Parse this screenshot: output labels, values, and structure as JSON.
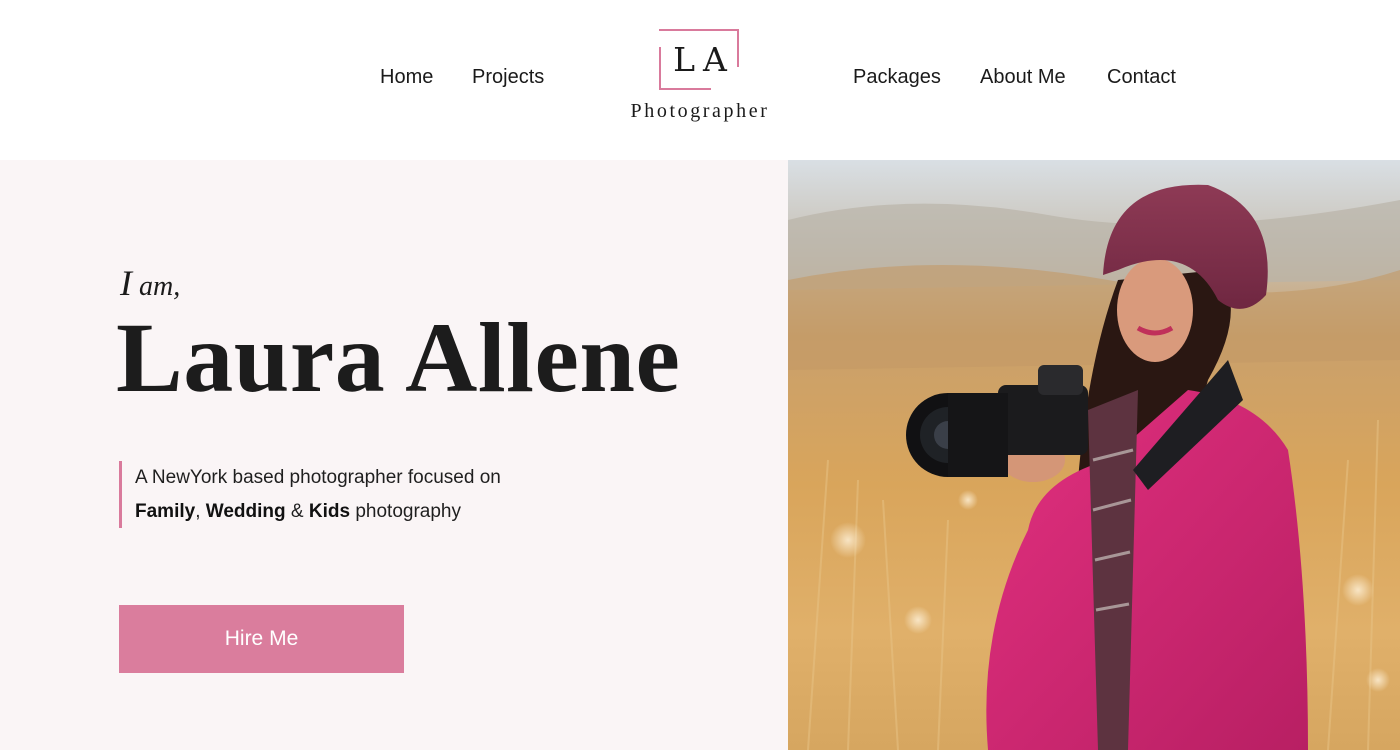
{
  "nav": {
    "left_items": [
      {
        "label": "Home"
      },
      {
        "label": "Projects"
      }
    ],
    "right_items": [
      {
        "label": "Packages"
      },
      {
        "label": "About Me"
      },
      {
        "label": "Contact"
      }
    ]
  },
  "logo": {
    "initials": "LA",
    "word": "Photographer",
    "accent_color": "#d97a9c"
  },
  "hero": {
    "intro_first": "I",
    "intro_rest": " am,",
    "name": "Laura Allene",
    "tagline_line1": "A NewYork based photographer focused on",
    "tagline_specialty_1": "Family",
    "tagline_sep_1": ",",
    "tagline_specialty_2": "Wedding",
    "tagline_sep_2": "&",
    "tagline_specialty_3": "Kids",
    "tagline_suffix": "photography",
    "cta_label": "Hire Me",
    "cta_color": "#da7d9d",
    "panel_background": "#faf5f6"
  },
  "photo": {
    "subject": "woman photographer in pink jacket and knit beret holding a camera in a golden field"
  }
}
